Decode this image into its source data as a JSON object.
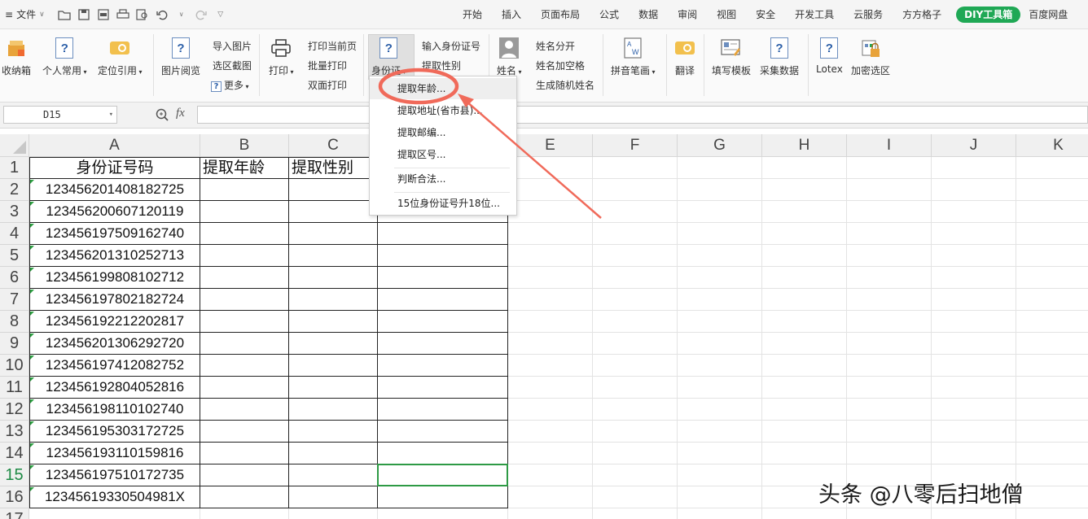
{
  "file_menu": {
    "label": "文件"
  },
  "tabs": [
    "开始",
    "插入",
    "页面布局",
    "公式",
    "数据",
    "审阅",
    "视图",
    "安全",
    "开发工具",
    "云服务",
    "方方格子"
  ],
  "active_tab": "DIY工具箱",
  "extra_tab": "百度网盘",
  "ribbon": {
    "collect": "收纳箱",
    "personal": "个人常用",
    "locate": "定位引用",
    "picview": "图片阅览",
    "import_pic": "导入图片",
    "region_shot": "选区截图",
    "more": "更多",
    "print": "打印",
    "print_current": "打印当前页",
    "batch_print": "批量打印",
    "duplex_print": "双面打印",
    "idcard": "身份证",
    "input_id": "输入身份证号",
    "extract_gender": "提取性别",
    "name": "姓名",
    "split_name": "姓名分开",
    "name_space": "姓名加空格",
    "random_name": "生成随机姓名",
    "pinyin": "拼音笔画",
    "translate": "翻译",
    "fill_template": "填写模板",
    "collect_data": "采集数据",
    "lotex": "Lotex",
    "encrypt": "加密选区"
  },
  "formula_bar": {
    "cell_ref": "D15",
    "fx": "fx"
  },
  "columns": [
    "A",
    "B",
    "C",
    "D",
    "E",
    "F",
    "G",
    "H",
    "I",
    "J",
    "K"
  ],
  "rows": [
    "1",
    "2",
    "3",
    "4",
    "5",
    "6",
    "7",
    "8",
    "9",
    "10",
    "11",
    "12",
    "13",
    "14",
    "15",
    "16",
    "17"
  ],
  "headers": {
    "a1": "身份证号码",
    "b1": "提取年龄",
    "c1": "提取性别"
  },
  "ids": [
    "123456201408182725",
    "123456200607120119",
    "123456197509162740",
    "123456201310252713",
    "123456199808102712",
    "123456197802182724",
    "123456192212202817",
    "123456201306292720",
    "123456197412082752",
    "123456192804052816",
    "123456198110102740",
    "123456195303172725",
    "123456193110159816",
    "123456197510172735",
    "12345619330504981X"
  ],
  "dropdown": [
    "提取年龄...",
    "提取地址(省市县)...",
    "提取邮编...",
    "提取区号...",
    "判断合法...",
    "15位身份证号升18位..."
  ],
  "watermark": "头条 @八零后扫地僧",
  "colors": {
    "accent_green": "#1fa855",
    "annotation": "#f06a5a",
    "selection": "#2e9a45"
  }
}
